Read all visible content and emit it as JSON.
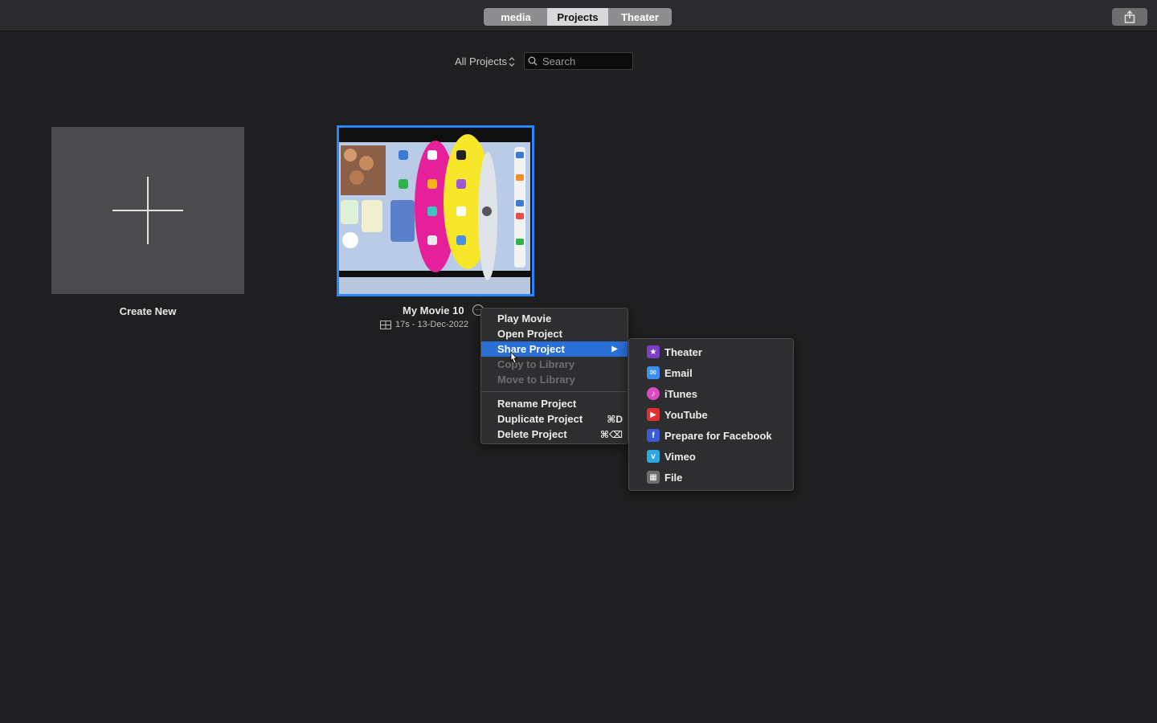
{
  "toolbar": {
    "tabs": [
      {
        "label": "media"
      },
      {
        "label": "Projects",
        "selected": true
      },
      {
        "label": "Theater"
      }
    ]
  },
  "filter": {
    "label": "All Projects",
    "search_placeholder": "Search"
  },
  "create_new": {
    "label": "Create New"
  },
  "project": {
    "title": "My Movie 10",
    "meta": "17s - 13-Dec-2022"
  },
  "context_menu": {
    "items": [
      {
        "label": "Play Movie"
      },
      {
        "label": "Open Project"
      },
      {
        "label": "Share Project",
        "active": true
      },
      {
        "label": "Copy to Library",
        "disabled": true
      },
      {
        "label": "Move to Library",
        "disabled": true
      },
      {
        "label": "Rename Project"
      },
      {
        "label": "Duplicate Project",
        "shortcut": "⌘D"
      },
      {
        "label": "Delete Project",
        "shortcut": "⌘⌫"
      }
    ]
  },
  "share_submenu": {
    "items": [
      {
        "label": "Theater",
        "icon": "star-icon",
        "color": "#9b59d6"
      },
      {
        "label": "Email",
        "icon": "email-icon",
        "color": "#3b8ff0"
      },
      {
        "label": "iTunes",
        "icon": "music-note-icon",
        "color": "#d94bc3"
      },
      {
        "label": "YouTube",
        "icon": "youtube-icon",
        "color": "#e03030"
      },
      {
        "label": "Prepare for Facebook",
        "icon": "facebook-icon",
        "color": "#3b5bd6"
      },
      {
        "label": "Vimeo",
        "icon": "vimeo-icon",
        "color": "#2aa8e0"
      },
      {
        "label": "File",
        "icon": "film-icon",
        "color": "#8a8a8a"
      }
    ]
  },
  "colors": {
    "background": "#1f1f21",
    "selection": "#2a86ff",
    "menu_highlight": "#2a6fd6"
  }
}
